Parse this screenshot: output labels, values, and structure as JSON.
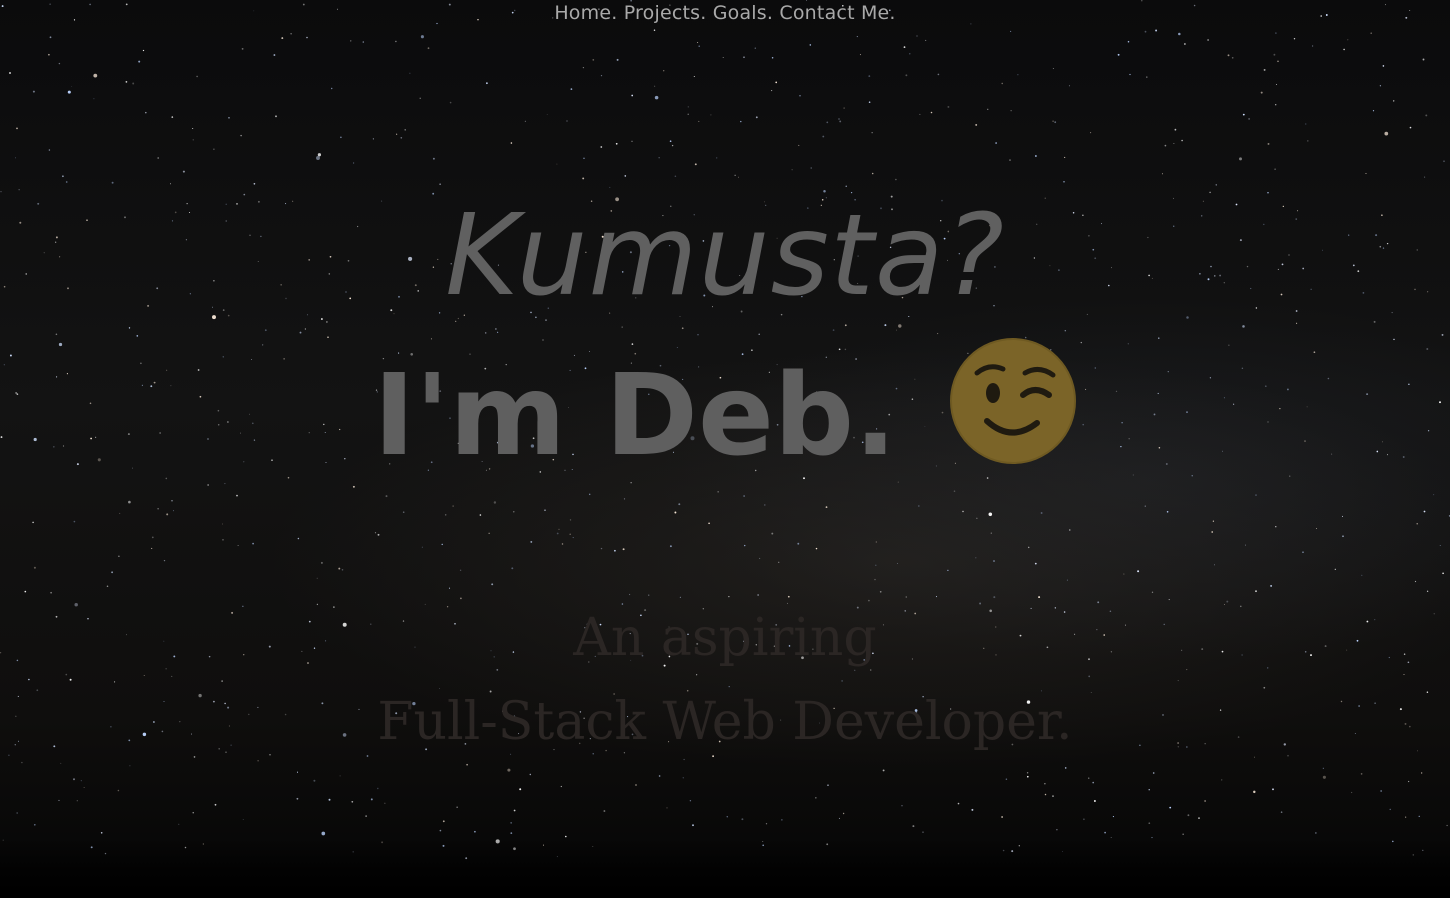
{
  "nav": {
    "items": [
      {
        "label": "Home."
      },
      {
        "label": "Projects."
      },
      {
        "label": "Goals."
      },
      {
        "label": "Contact Me."
      }
    ]
  },
  "hero": {
    "greeting": "Kumusta?",
    "name": "I'm Deb.",
    "emoji_icon": "winking-face-icon",
    "tagline_line1": "An aspiring",
    "tagline_line2": "Full-Stack Web Developer."
  },
  "colors": {
    "nav_text": "#a9a9a9",
    "heading_text": "#606060",
    "tagline_text": "#2b2624",
    "emoji": "#7d6628",
    "background": "#0f0f10"
  }
}
